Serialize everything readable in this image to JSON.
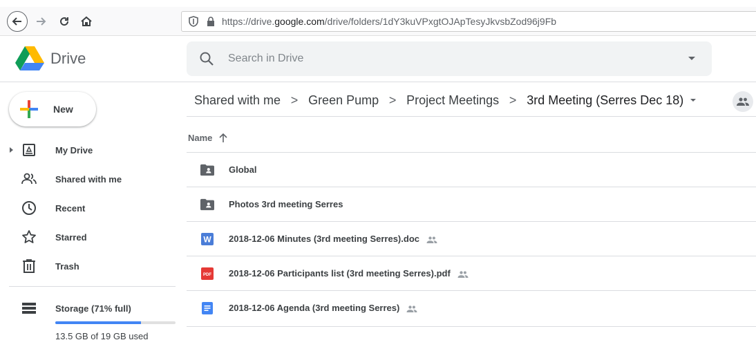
{
  "browser": {
    "url_prefix": "https://drive.",
    "url_domain": "google.com",
    "url_path": "/drive/folders/1dY3kuVPxgtOJApTesyJkvsbZod96j9Fb"
  },
  "app": {
    "name": "Drive"
  },
  "search": {
    "placeholder": "Search in Drive"
  },
  "new_button": {
    "label": "New"
  },
  "sidebar": {
    "items": [
      {
        "label": "My Drive",
        "icon": "my-drive-icon"
      },
      {
        "label": "Shared with me",
        "icon": "people-icon"
      },
      {
        "label": "Recent",
        "icon": "clock-icon"
      },
      {
        "label": "Starred",
        "icon": "star-icon"
      },
      {
        "label": "Trash",
        "icon": "trash-icon"
      }
    ]
  },
  "storage": {
    "label": "Storage (71% full)",
    "used_text": "13.5 GB of 19 GB used",
    "fraction": 0.71
  },
  "breadcrumb": {
    "items": [
      "Shared with me",
      "Green Pump",
      "Project Meetings",
      "3rd Meeting (Serres Dec 18)"
    ],
    "separator": ">"
  },
  "file_list": {
    "column_header": "Name",
    "rows": [
      {
        "name": "Global",
        "type": "shared-folder-icon",
        "shared": false
      },
      {
        "name": "Photos 3rd meeting Serres",
        "type": "shared-folder-icon",
        "shared": false
      },
      {
        "name": "2018-12-06 Minutes (3rd meeting Serres).doc",
        "type": "word-doc-icon",
        "shared": true
      },
      {
        "name": "2018-12-06 Participants list (3rd meeting Serres).pdf",
        "type": "pdf-icon",
        "shared": true
      },
      {
        "name": "2018-12-06 Agenda (3rd meeting Serres)",
        "type": "google-doc-icon",
        "shared": true
      }
    ]
  },
  "colors": {
    "accent": "#4285f4",
    "word": "#4a7dd8",
    "pdf": "#e53935",
    "folder": "#5f6368"
  },
  "icons": {
    "word_letter": "W",
    "pdf_letter": "PDF"
  }
}
